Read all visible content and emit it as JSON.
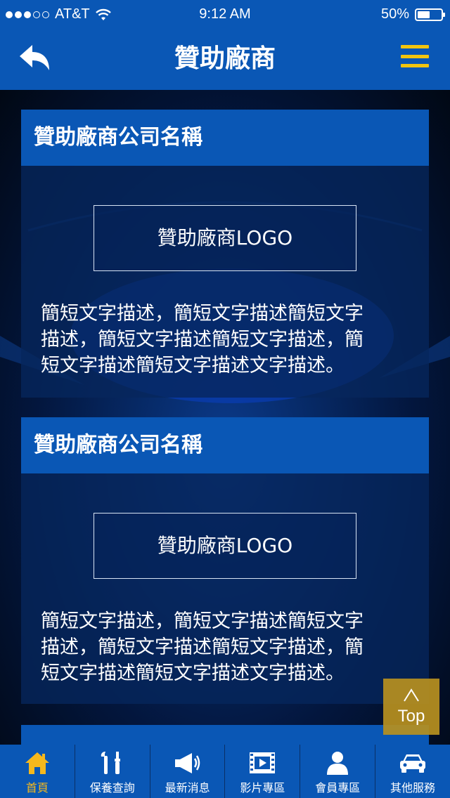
{
  "status_bar": {
    "carrier": "AT&T",
    "time": "9:12 AM",
    "battery": "50%",
    "battery_level": 0.5,
    "signal_bars": 3,
    "signal_total": 5
  },
  "nav": {
    "title": "贊助廠商",
    "back_icon": "back-arrow-icon",
    "menu_icon": "hamburger-menu-icon"
  },
  "cards": [
    {
      "title": "贊助廠商公司名稱",
      "logo": "贊助廠商LOGO",
      "desc_lines": [
        "簡短文字描述，簡短文字描述簡短文字",
        "描述，簡短文字描述簡短文字描述，簡",
        "短文字描述簡短文字描述文字描述。"
      ]
    },
    {
      "title": "贊助廠商公司名稱",
      "logo": "贊助廠商LOGO",
      "desc_lines": [
        "簡短文字描述，簡短文字描述簡短文字",
        "描述，簡短文字描述簡短文字描述，簡",
        "短文字描述簡短文字描述文字描述。"
      ]
    }
  ],
  "top_button": {
    "label": "Top",
    "icon": "chevron-up-icon"
  },
  "tabs": [
    {
      "label": "首頁",
      "icon": "home-icon",
      "active": true
    },
    {
      "label": "保養查詢",
      "icon": "tools-icon",
      "active": false
    },
    {
      "label": "最新消息",
      "icon": "megaphone-icon",
      "active": false
    },
    {
      "label": "影片專區",
      "icon": "film-icon",
      "active": false
    },
    {
      "label": "會員專區",
      "icon": "user-icon",
      "active": false
    },
    {
      "label": "其他服務",
      "icon": "car-icon",
      "active": false
    }
  ],
  "colors": {
    "bar_blue": "#0a57b5",
    "accent_yellow": "#f1c40f",
    "active_tab": "#f5b81d",
    "top_button": "#b79020"
  }
}
